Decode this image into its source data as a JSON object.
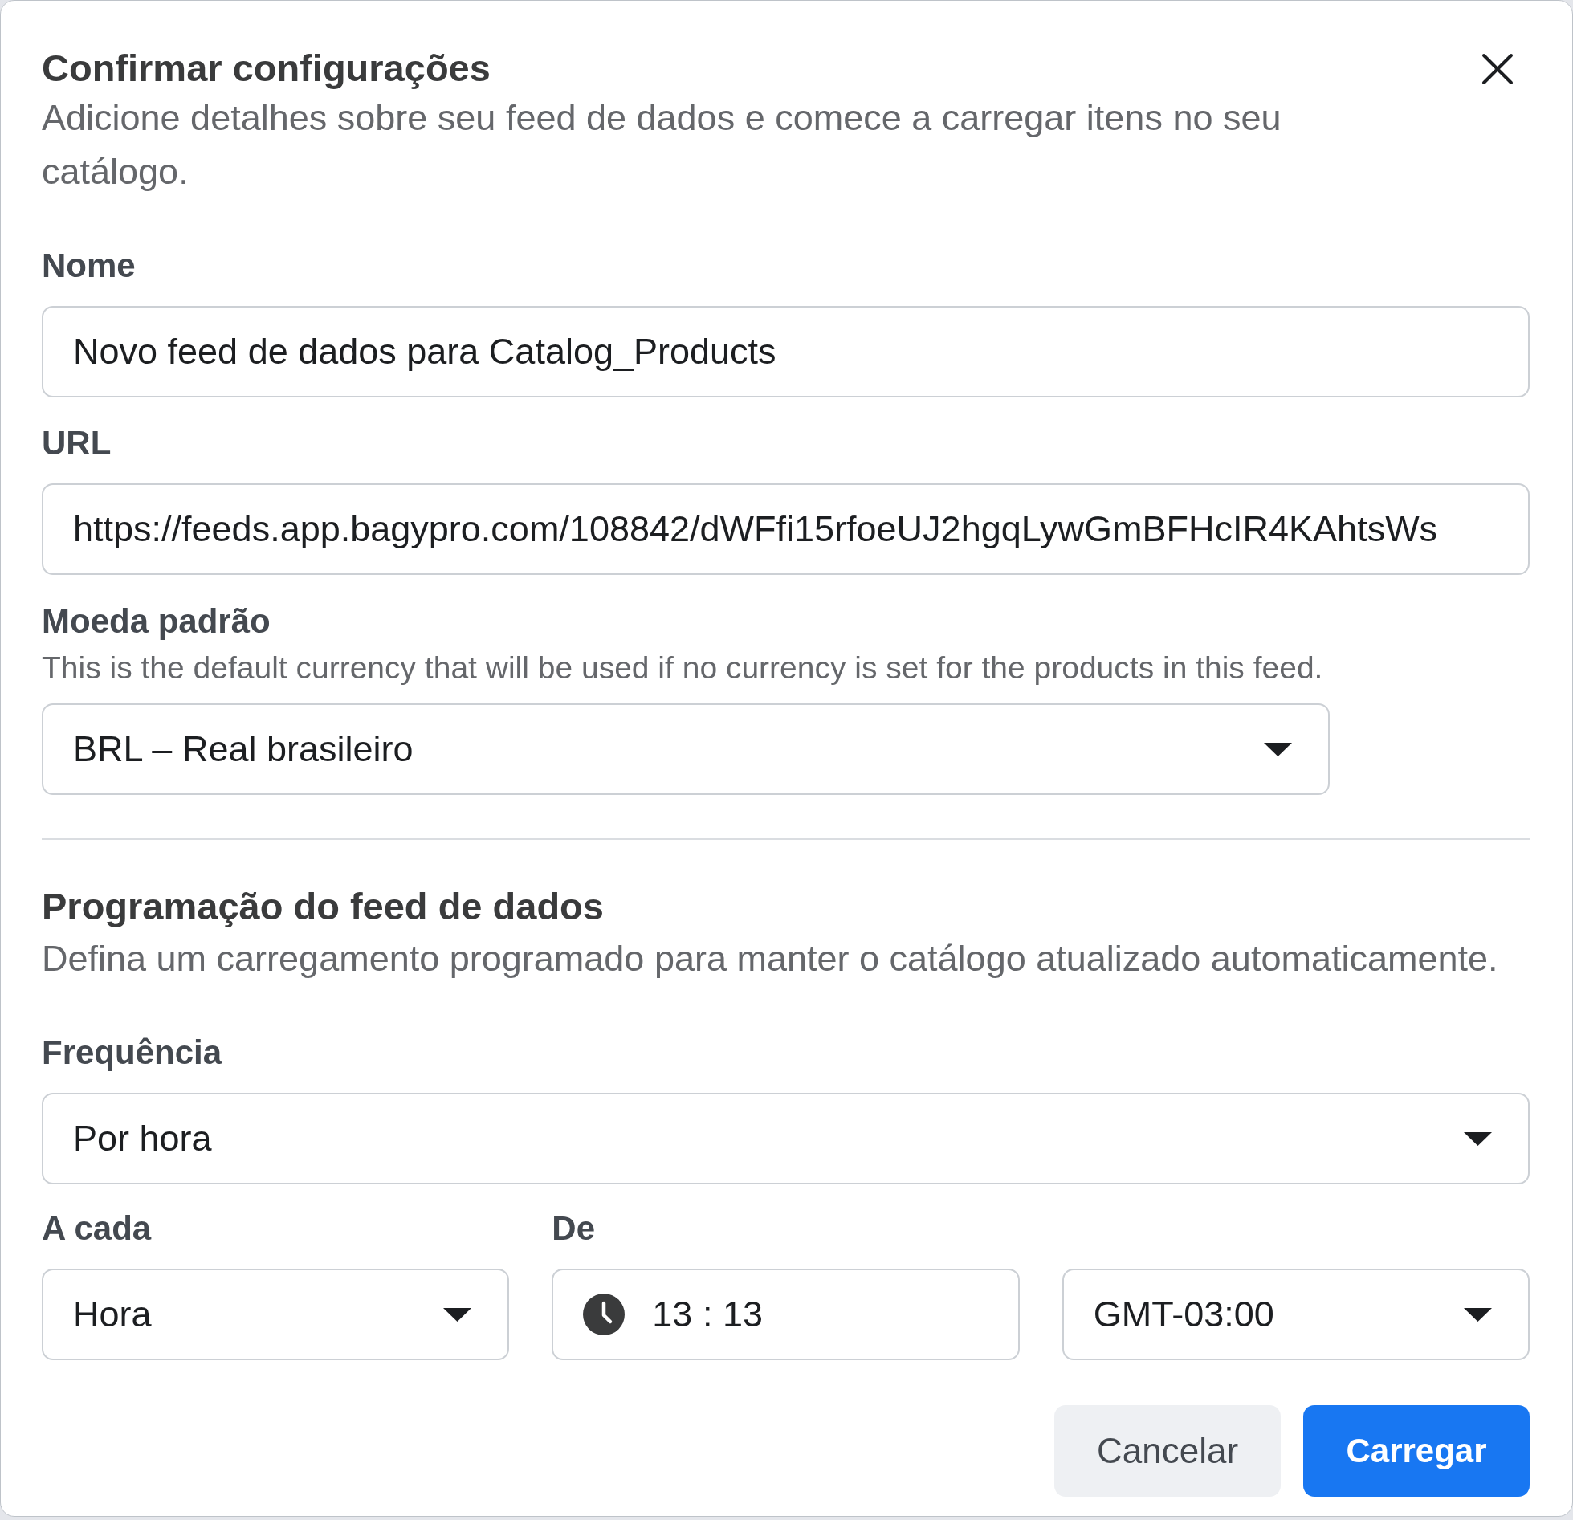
{
  "dialog": {
    "title": "Confirmar configurações",
    "description": "Adicione detalhes sobre seu feed de dados e comece a carregar itens no seu catálogo."
  },
  "feed": {
    "name": {
      "label": "Nome",
      "value": "Novo feed de dados para Catalog_Products"
    },
    "url": {
      "label": "URL",
      "value": "https://feeds.app.bagypro.com/108842/dWFfi15rfoeUJ2hgqLywGmBFHcIR4KAhtsWs"
    },
    "currency": {
      "label": "Moeda padrão",
      "help": "This is the default currency that will be used if no currency is set for the products in this feed.",
      "value": "BRL – Real brasileiro"
    }
  },
  "schedule": {
    "title": "Programação do feed de dados",
    "description": "Defina um carregamento programado para manter o catálogo atualizado automaticamente.",
    "frequency": {
      "label": "Frequência",
      "value": "Por hora"
    },
    "interval": {
      "label": "A cada",
      "value": "Hora"
    },
    "start": {
      "label": "De",
      "time": "13 : 13",
      "timezone": "GMT-03:00"
    }
  },
  "buttons": [
    {
      "kind": "secondary",
      "label": "Cancelar"
    },
    {
      "kind": "primary",
      "label": "Carregar"
    }
  ]
}
